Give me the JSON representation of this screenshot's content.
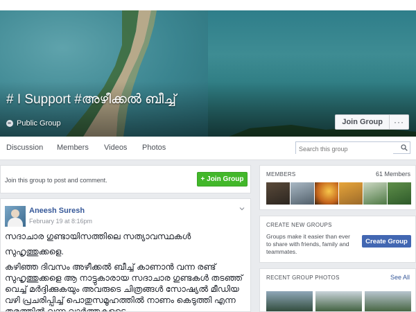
{
  "cover": {
    "title": "# I Support #അഴീക്കൽ ബീച്ച്",
    "privacy": "Public Group",
    "join_button": "Join Group",
    "more_button": "···"
  },
  "nav": {
    "tabs": [
      "Discussion",
      "Members",
      "Videos",
      "Photos"
    ],
    "search_placeholder": "Search this group"
  },
  "join_card": {
    "text": "Join this group to post and comment.",
    "button": "+ Join Group"
  },
  "post": {
    "author": "Aneesh Suresh",
    "time": "February 19 at 8:16pm",
    "paragraphs": [
      "സദാചാര ഗുണ്ടായിസത്തിലെ സത്യാവസ്ഥകൾ",
      "സുഹൃത്തുക്കളെ.",
      "കഴിഞ്ഞ ദിവസം അഴീക്കൽ ബീച്ച് കാണാൻ വന്ന രണ്ട് സുഹൃത്തുക്കളെ ആ നാട്ടുകാരായ സദാചാര ഗുണ്ടകൾ തടഞ്ഞ് വെച്ച് മർദ്ദിക്കുകയും അവരുടെ ചിത്രങ്ങൾ സോഷ്യൽ മീഡിയ വഴി പ്രചരിപ്പിച്ച് പൊതുസമൂഹത്തിൽ നാണം കെടുത്തി എന്ന തരത്തിൽ വന്ന വാർത്തകളുടെ"
    ]
  },
  "members": {
    "heading": "MEMBERS",
    "count": "61 Members"
  },
  "create": {
    "heading": "CREATE NEW GROUPS",
    "description": "Groups make it easier than ever to share with friends, family and teammates.",
    "button": "Create Group"
  },
  "photos": {
    "heading": "RECENT GROUP PHOTOS",
    "see_all": "See All"
  },
  "colors": {
    "join_green": "#42b72a",
    "brand_blue": "#4267b2",
    "link_blue": "#365899"
  }
}
